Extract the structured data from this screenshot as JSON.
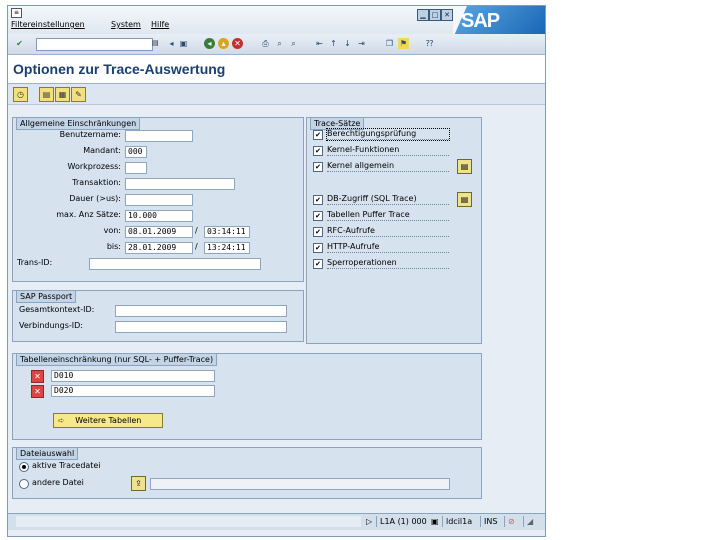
{
  "menu": {
    "items": [
      "Filtereinstellungen",
      "System",
      "Hilfe"
    ]
  },
  "window_controls": [
    "minimize-icon",
    "maximize-icon",
    "close-icon"
  ],
  "logo": "SAP",
  "toolbar": {
    "command_field_value": "",
    "icons": [
      "enter-icon",
      "save-icon",
      "back-icon",
      "exit-icon",
      "cancel-icon",
      "print-icon",
      "find-icon",
      "find-next-icon",
      "first-page-icon",
      "previous-page-icon",
      "next-page-icon",
      "last-page-icon",
      "create-session-icon",
      "shortcut-icon",
      "help-icon"
    ]
  },
  "page_title": "Optionen zur Trace-Auswertung",
  "app_toolbar": {
    "icons": [
      "execute-icon",
      "variant-icon",
      "save-variant-icon",
      "variant-settings-icon"
    ]
  },
  "general": {
    "title": "Allgemeine Einschränkungen",
    "user_label": "Benutzername:",
    "user_value": "",
    "client_label": "Mandant:",
    "client_value": "000",
    "workproc_label": "Workprozess:",
    "workproc_value": "",
    "transaction_label": "Transaktion:",
    "transaction_value": "",
    "duration_label": "Dauer (>us):",
    "duration_value": "",
    "maxrec_label": "max. Anz Sätze:",
    "maxrec_value": "10.000",
    "from_label": "von:",
    "from_date": "08.01.2009",
    "from_time": "03:14:11",
    "to_label": "bis:",
    "to_date": "28.01.2009",
    "to_time": "13:24:11",
    "separator": "/",
    "transid_label": "Trans-ID:",
    "transid_value": ""
  },
  "trace": {
    "title": "Trace-Sätze",
    "items": [
      {
        "label": "Berechtigungsprüfung",
        "checked": true
      },
      {
        "label": "Kernel-Funktionen",
        "checked": true
      },
      {
        "label": "Kernel allgemein",
        "checked": true
      },
      {
        "label": "DB-Zugriff (SQL Trace)",
        "checked": true
      },
      {
        "label": "Tabellen Puffer Trace",
        "checked": true
      },
      {
        "label": "RFC-Aufrufe",
        "checked": true
      },
      {
        "label": "HTTP-Aufrufe",
        "checked": true
      },
      {
        "label": "Sperroperationen",
        "checked": true
      }
    ]
  },
  "passport": {
    "title": "SAP Passport",
    "context_label": "Gesamtkontext-ID:",
    "context_value": "",
    "connection_label": "Verbindungs-ID:",
    "connection_value": ""
  },
  "tables": {
    "title": "Tabelleneinschränkung (nur SQL- + Puffer-Trace)",
    "rows": [
      "D010",
      "D020"
    ],
    "more_button": "Weitere Tabellen"
  },
  "file": {
    "title": "Dateiauswahl",
    "active_label": "aktive Tracedatei",
    "other_label": "andere Datei",
    "selected": "active",
    "path_value": ""
  },
  "statusbar": {
    "system": "L1A (1) 000",
    "server": "ldcil1a",
    "mode": "INS"
  }
}
